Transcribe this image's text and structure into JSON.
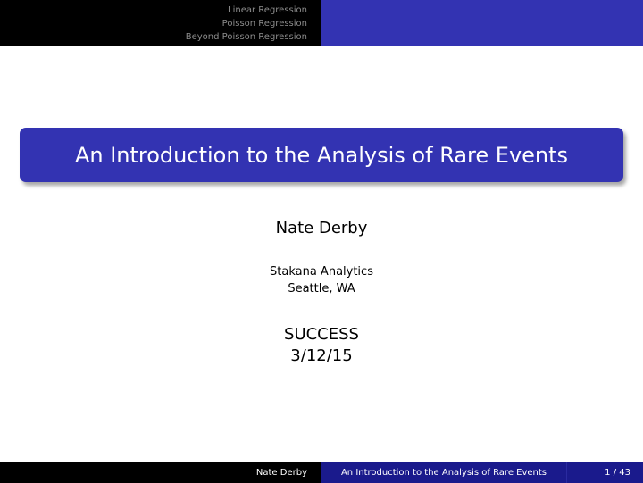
{
  "header": {
    "nav": [
      "Linear Regression",
      "Poisson Regression",
      "Beyond Poisson Regression"
    ]
  },
  "slide": {
    "title": "An Introduction to the Analysis of Rare Events",
    "author": "Nate Derby",
    "institute_line1": "Stakana Analytics",
    "institute_line2": "Seattle, WA",
    "event_line1": "SUCCESS",
    "event_line2": "3/12/15"
  },
  "footer": {
    "author": "Nate Derby",
    "title": "An Introduction to the Analysis of Rare Events",
    "page": "1 / 43"
  },
  "colors": {
    "header_left": "#000000",
    "header_right": "#3333b2",
    "title_box": "#3333b2",
    "footer_dark": "#1a1a8c"
  }
}
